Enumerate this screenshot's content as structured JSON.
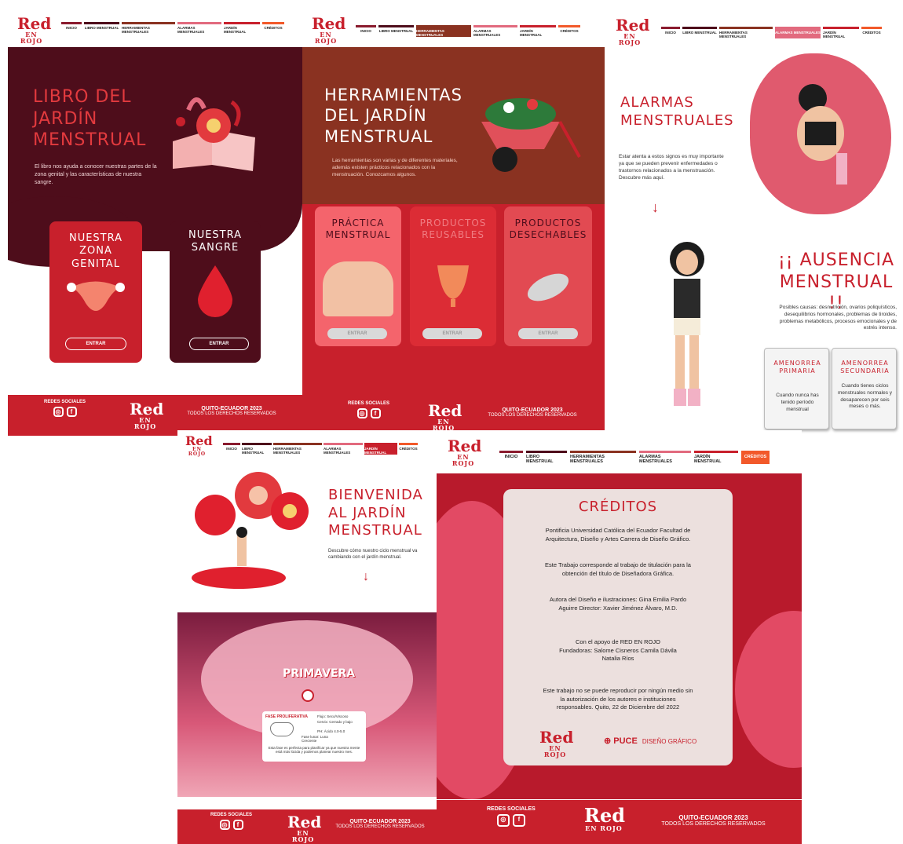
{
  "brand": {
    "logo_main": "Red",
    "logo_sub": "EN ROJO",
    "accent": "#c8202c",
    "wine": "#4e0d1b",
    "rust": "#8a3221"
  },
  "nav": [
    "INICIO",
    "LIBRO MENSTRUAL",
    "HERRAMIENTAS MENSTRUALES",
    "ALARMAS MENSTRUALES",
    "JARDÍN MENSTRUAL",
    "CRÉDITOS"
  ],
  "nav_colors": [
    "#8a1b2e",
    "#4e0d1b",
    "#8a3221",
    "#e26a7e",
    "#c8202c",
    "#f2592a"
  ],
  "footer": {
    "social": "REDES SOCIALES",
    "city": "QUITO-ECUADOR 2023",
    "rights": "TODOS LOS DERECHOS RESERVADOS"
  },
  "libro": {
    "title": "LIBRO DEL JARDÍN MENSTRUAL",
    "body": "El libro nos ayuda a conocer nuestras partes de la zona genital y las características de nuestra sangre.",
    "cards": [
      {
        "title": "NUESTRA ZONA GENITAL",
        "button": "ENTRAR"
      },
      {
        "title": "NUESTRA SANGRE",
        "button": "ENTRAR"
      }
    ]
  },
  "herramientas": {
    "title": "HERRAMIENTAS DEL JARDÍN MENSTRUAL",
    "body": "Las herramientas son varias y de diferentes materiales, además existen prácticos relacionados con la menstruación. Conozcamos algunos.",
    "cards": [
      {
        "title": "PRÁCTICA MENSTRUAL",
        "button": "ENTRAR"
      },
      {
        "title": "PRODUCTOS REUSABLES",
        "button": "ENTRAR"
      },
      {
        "title": "PRODUCTOS DESECHABLES",
        "button": "ENTRAR"
      }
    ]
  },
  "alarmas": {
    "title": "ALARMAS MENSTRUALES",
    "body": "Estar atenta a estos signos es muy importante ya que se pueden prevenir enfermedades o trastornos relacionados a la menstruación. Descubre más aquí.",
    "ausencia_title": "¡¡ AUSENCIA MENSTRUAL !!",
    "ausencia_body": "Posibles causas: desnutrición, ovarios poliquísticos, desequilibrios hormonales, problemas de tiroides, problemas metabólicos, procesos emocionales y de estrés intenso.",
    "cards": [
      {
        "title": "AMENORREA PRIMARIA",
        "body": "Cuando nunca has tenido período menstrual"
      },
      {
        "title": "AMENORREA SECUNDARIA",
        "body": "Cuando tienes ciclos menstruales normales y desaparecen por seis meses o más."
      }
    ]
  },
  "jardin": {
    "title": "BIENVENIDA AL JARDÍN MENSTRUAL",
    "body": "Descubre cómo nuestro ciclo menstrual va cambiando con el jardín menstrual.",
    "season": "PRIMAVERA",
    "popup": {
      "title": "FASE PROLIFERATIVA",
      "flujo": "Flujo: Seco/Viscoso",
      "cervix": "Cervix: Cerrado y bajo",
      "ph": "PH: Ácido 4.0-5.0",
      "lunar": "Fase lunar: Luna Creciente",
      "note": "Esta fase es perfecta para planificar ya que nuestra mente está más lúcida y podemos planear nuestro mes."
    }
  },
  "creditos": {
    "title": "CRÉDITOS",
    "paras": [
      "Pontificia Universidad Católica del Ecuador Facultad de Arquitectura, Diseño y Artes Carrera de Diseño Gráfico.",
      "Este Trabajo corresponde al trabajo de titulación para la obtención del título de Diseñadora Gráfica.",
      "Autora del Diseño e ilustraciones: Gina Emilia Pardo Aguirre Director: Xavier Jiménez Álvaro, M.D.",
      "Con el apoyo de RED EN ROJO Fundadoras: Salome Cisneros Camila Dávila Natalia Ríos",
      "Este trabajo no se puede reproducir por ningún medio sin la autorización de los autores e instituciones responsables. Quito, 22 de Diciembre del 2022"
    ],
    "puce": "PUCE",
    "puce_sub": "DISEÑO GRÁFICO"
  }
}
